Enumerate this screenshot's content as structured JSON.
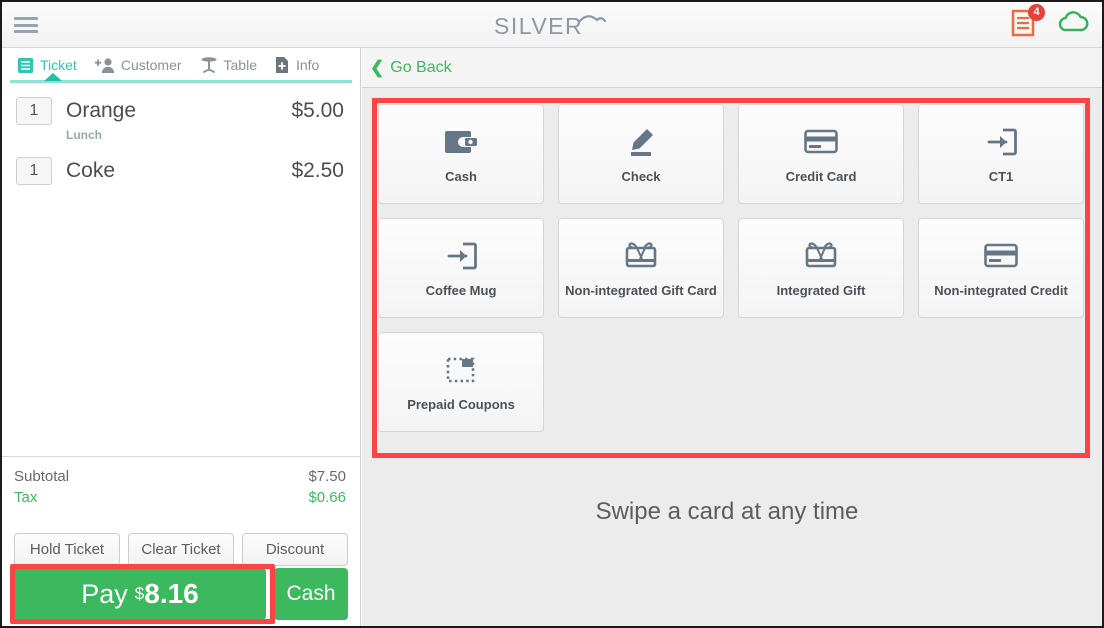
{
  "topbar": {
    "menu_icon": "hamburger-icon",
    "logo_text": "SILVER",
    "receipt_icon": "receipt-icon",
    "receipt_badge": "4",
    "cloud_icon": "cloud-icon"
  },
  "left_panel": {
    "tabs": [
      {
        "label": "Ticket",
        "icon": "ticket-icon",
        "active": true
      },
      {
        "label": "Customer",
        "icon": "add-person-icon",
        "active": false
      },
      {
        "label": "Table",
        "icon": "table-icon",
        "active": false
      },
      {
        "label": "Info",
        "icon": "document-plus-icon",
        "active": false
      }
    ],
    "items": [
      {
        "qty": "1",
        "name": "Orange",
        "price": "$5.00",
        "modifier": "Lunch"
      },
      {
        "qty": "1",
        "name": "Coke",
        "price": "$2.50",
        "modifier": ""
      }
    ],
    "totals": [
      {
        "label": "Subtotal",
        "value": "$7.50"
      },
      {
        "label": "Tax",
        "value": "$0.66"
      }
    ],
    "actions": [
      {
        "label": "Hold Ticket"
      },
      {
        "label": "Clear Ticket"
      },
      {
        "label": "Discount"
      }
    ],
    "pay": {
      "label": "Pay",
      "currency": "$",
      "amount": "8.16",
      "cash_label": "Cash"
    }
  },
  "right_panel": {
    "go_back": "Go Back",
    "swipe_hint": "Swipe a card at any time",
    "tenders": [
      {
        "label": "Cash",
        "icon": "wallet-icon"
      },
      {
        "label": "Check",
        "icon": "pencil-signature-icon"
      },
      {
        "label": "Credit Card",
        "icon": "credit-card-icon"
      },
      {
        "label": "CT1",
        "icon": "arrow-into-box-icon"
      },
      {
        "label": "Coffee Mug",
        "icon": "arrow-into-box-icon"
      },
      {
        "label": "Non-integrated Gift Card",
        "icon": "gift-card-icon"
      },
      {
        "label": "Integrated Gift",
        "icon": "gift-card-icon"
      },
      {
        "label": "Non-integrated Credit",
        "icon": "credit-card-icon"
      },
      {
        "label": "Prepaid Coupons",
        "icon": "dashed-coupon-icon"
      }
    ]
  },
  "colors": {
    "green": "#3cb95f",
    "teal": "#32c5b0",
    "highlight_red": "#fc4444",
    "badge_red": "#e8413a",
    "icon_slate": "#657786"
  }
}
